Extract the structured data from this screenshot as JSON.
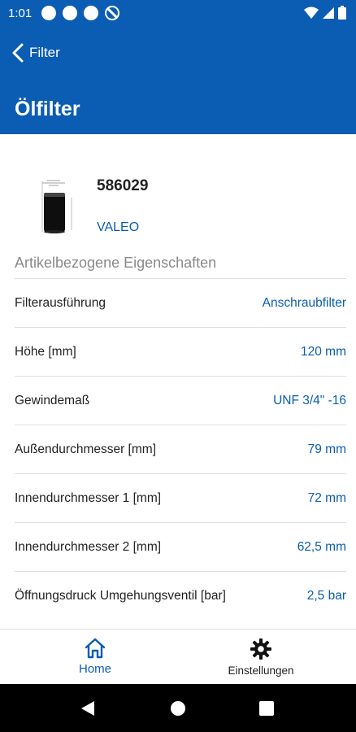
{
  "status_bar": {
    "time": "1:01"
  },
  "header": {
    "back_label": "Filter",
    "title": "Ölfilter"
  },
  "product": {
    "article_number": "586029",
    "brand": "VALEO"
  },
  "section_title": "Artikelbezogene Eigenschaften",
  "properties": [
    {
      "label": "Filterausführung",
      "value": "Anschraubfilter"
    },
    {
      "label": "Höhe [mm]",
      "value": "120 mm"
    },
    {
      "label": "Gewindemaß",
      "value": "UNF 3/4\" -16"
    },
    {
      "label": "Außendurchmesser [mm]",
      "value": "79 mm"
    },
    {
      "label": "Innendurchmesser 1 [mm]",
      "value": "72 mm"
    },
    {
      "label": "Innendurchmesser 2 [mm]",
      "value": "62,5 mm"
    },
    {
      "label": "Öffnungsdruck Umgehungsventil [bar]",
      "value": "2,5 bar"
    }
  ],
  "bottom_nav": {
    "home_label": "Home",
    "settings_label": "Einstellungen"
  },
  "colors": {
    "primary": "#0a5db2",
    "value_text": "#0a5db2",
    "section_title": "#8a8a8a"
  },
  "icons": {
    "back": "chevron-left-icon",
    "home": "home-icon",
    "settings": "gear-icon"
  }
}
